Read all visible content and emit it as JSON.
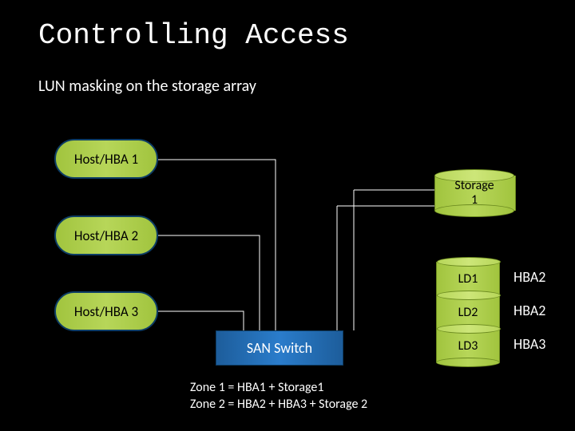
{
  "title": "Controlling Access",
  "subtitle": "LUN masking on the storage array",
  "hosts": [
    {
      "label": "Host/HBA 1"
    },
    {
      "label": "Host/HBA 2"
    },
    {
      "label": "Host/HBA 3"
    }
  ],
  "storage": {
    "label_line1": "Storage",
    "label_line2": "1"
  },
  "san_switch": {
    "label": "SAN Switch"
  },
  "logical_disks": [
    {
      "ld": "LD1",
      "maps_to": "HBA2"
    },
    {
      "ld": "LD2",
      "maps_to": "HBA2"
    },
    {
      "ld": "LD3",
      "maps_to": "HBA3"
    }
  ],
  "zones": [
    "Zone 1 = HBA1 + Storage1",
    "Zone 2 = HBA2 + HBA3 + Storage 2"
  ],
  "chart_data": {
    "type": "diagram",
    "nodes": [
      "Host/HBA 1",
      "Host/HBA 2",
      "Host/HBA 3",
      "SAN Switch",
      "Storage 1",
      "LD1",
      "LD2",
      "LD3"
    ],
    "edges": [
      [
        "Host/HBA 1",
        "SAN Switch"
      ],
      [
        "Host/HBA 2",
        "SAN Switch"
      ],
      [
        "Host/HBA 3",
        "SAN Switch"
      ],
      [
        "SAN Switch",
        "Storage 1"
      ]
    ],
    "lun_masking": [
      {
        "ld": "LD1",
        "hba": "HBA2"
      },
      {
        "ld": "LD2",
        "hba": "HBA2"
      },
      {
        "ld": "LD3",
        "hba": "HBA3"
      }
    ],
    "zoning": [
      {
        "name": "Zone 1",
        "members": [
          "HBA1",
          "Storage1"
        ]
      },
      {
        "name": "Zone 2",
        "members": [
          "HBA2",
          "HBA3",
          "Storage 2"
        ]
      }
    ]
  }
}
